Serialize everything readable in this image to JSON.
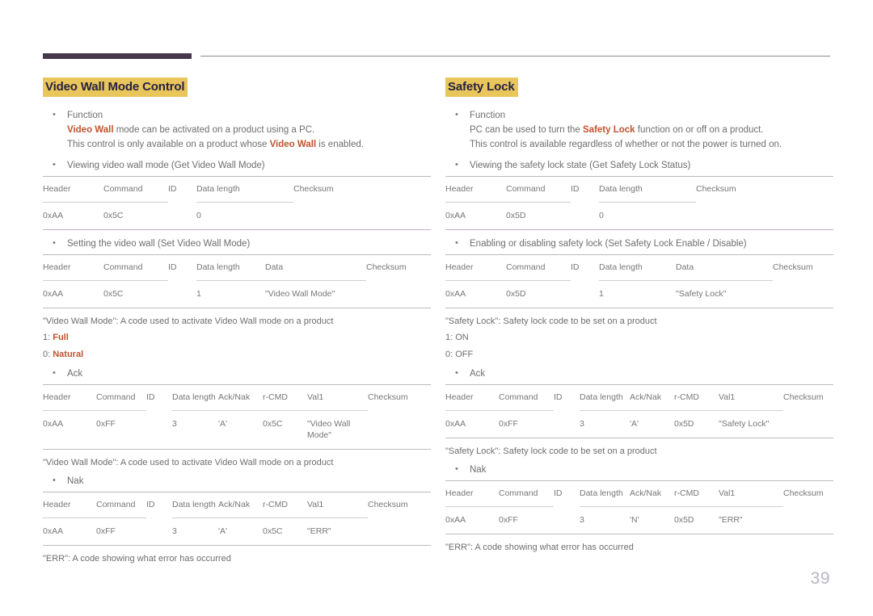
{
  "page": {
    "number": "39",
    "accent_color": "#c2522c",
    "highlight_color": "#e9c65c",
    "rule_color": "#c6b2c6"
  },
  "left": {
    "title": "Video Wall Mode Control",
    "function_label": "Function",
    "function_line1_a": "Video Wall",
    "function_line1_b": " mode can be activated on a product using a PC.",
    "function_line2_a": "This control is only available on a product whose ",
    "function_line2_b": "Video Wall",
    "function_line2_c": " is enabled.",
    "get_label": "Viewing video wall mode (Get Video Wall Mode)",
    "get_table": {
      "headers": [
        "Header",
        "Command",
        "ID",
        "Data length",
        "Checksum"
      ],
      "row": [
        "0xAA",
        "0x5C",
        "",
        "0",
        ""
      ]
    },
    "set_label": "Setting the video wall (Set Video Wall Mode)",
    "set_table": {
      "headers": [
        "Header",
        "Command",
        "ID",
        "Data length",
        "Data",
        "Checksum"
      ],
      "row": [
        "0xAA",
        "0x5C",
        "",
        "1",
        "\"Video Wall Mode\"",
        ""
      ]
    },
    "set_caption": "\"Video Wall Mode\": A code used to activate Video Wall mode on a product",
    "code_1_prefix": "1: ",
    "code_1_value": "Full",
    "code_0_prefix": "0: ",
    "code_0_value": "Natural",
    "ack_label": "Ack",
    "ack_table": {
      "headers": [
        "Header",
        "Command",
        "ID",
        "Data length",
        "Ack/Nak",
        "r-CMD",
        "Val1",
        "Checksum"
      ],
      "row": [
        "0xAA",
        "0xFF",
        "",
        "3",
        "'A'",
        "0x5C",
        "\"Video Wall Mode\"",
        ""
      ]
    },
    "ack_caption": "\"Video Wall Mode\": A code used to activate Video Wall mode on a product",
    "nak_label": "Nak",
    "nak_table": {
      "headers": [
        "Header",
        "Command",
        "ID",
        "Data length",
        "Ack/Nak",
        "r-CMD",
        "Val1",
        "Checksum"
      ],
      "row": [
        "0xAA",
        "0xFF",
        "",
        "3",
        "'A'",
        "0x5C",
        "\"ERR\"",
        ""
      ]
    },
    "nak_caption": "\"ERR\": A code showing what error has occurred"
  },
  "right": {
    "title": "Safety Lock",
    "function_label": "Function",
    "function_line1_a": "PC can be used to turn the ",
    "function_line1_b": "Safety Lock",
    "function_line1_c": " function on or off on a product.",
    "function_line2": "This control is available regardless of whether or not the power is turned on.",
    "get_label": "Viewing the safety lock state (Get Safety Lock Status)",
    "get_table": {
      "headers": [
        "Header",
        "Command",
        "ID",
        "Data length",
        "Checksum"
      ],
      "row": [
        "0xAA",
        "0x5D",
        "",
        "0",
        ""
      ]
    },
    "set_label": "Enabling or disabling safety lock (Set Safety Lock Enable / Disable)",
    "set_table": {
      "headers": [
        "Header",
        "Command",
        "ID",
        "Data length",
        "Data",
        "Checksum"
      ],
      "row": [
        "0xAA",
        "0x5D",
        "",
        "1",
        "\"Safety Lock\"",
        ""
      ]
    },
    "set_caption": "\"Safety Lock\": Safety lock code to be set on a product",
    "code_1": "1: ON",
    "code_0": "0: OFF",
    "ack_label": "Ack",
    "ack_table": {
      "headers": [
        "Header",
        "Command",
        "ID",
        "Data length",
        "Ack/Nak",
        "r-CMD",
        "Val1",
        "Checksum"
      ],
      "row": [
        "0xAA",
        "0xFF",
        "",
        "3",
        "'A'",
        "0x5D",
        "\"Safety Lock\"",
        ""
      ]
    },
    "ack_caption": "\"Safety Lock\": Safety lock code to be set on a product",
    "nak_label": "Nak",
    "nak_table": {
      "headers": [
        "Header",
        "Command",
        "ID",
        "Data length",
        "Ack/Nak",
        "r-CMD",
        "Val1",
        "Checksum"
      ],
      "row": [
        "0xAA",
        "0xFF",
        "",
        "3",
        "'N'",
        "0x5D",
        "\"ERR\"",
        ""
      ]
    },
    "nak_caption": "\"ERR\": A code showing what error has occurred"
  }
}
